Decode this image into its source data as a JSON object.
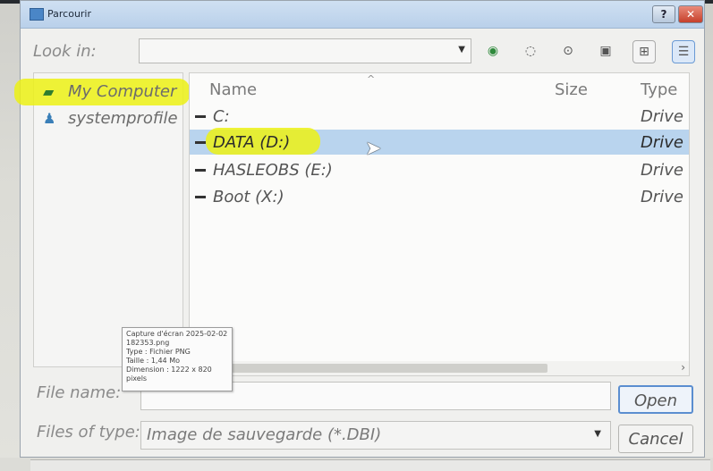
{
  "window": {
    "title": "Parcourir",
    "help_label": "?",
    "close_label": "✕"
  },
  "toolbar": {
    "lookin_label": "Look in:",
    "lookin_value": "",
    "icons": [
      "back-icon",
      "forward-icon",
      "up-icon",
      "new-folder-icon",
      "list-view-icon",
      "detail-view-icon"
    ]
  },
  "sidebar": {
    "items": [
      {
        "label": "My Computer",
        "icon": "computer-icon"
      },
      {
        "label": "systemprofile",
        "icon": "user-profile-icon"
      }
    ]
  },
  "filelist": {
    "columns": {
      "name": "Name",
      "size": "Size",
      "type": "Type"
    },
    "rows": [
      {
        "name": "C:",
        "size": "",
        "type": "Drive",
        "selected": false
      },
      {
        "name": "DATA (D:)",
        "size": "",
        "type": "Drive",
        "selected": true
      },
      {
        "name": "HASLEOBS (E:)",
        "size": "",
        "type": "Drive",
        "selected": false
      },
      {
        "name": "Boot (X:)",
        "size": "",
        "type": "Drive",
        "selected": false
      }
    ]
  },
  "form": {
    "file_name_label": "File name:",
    "file_name_value": "",
    "files_of_type_label": "Files of type:",
    "files_of_type_value": "Image de sauvegarde (*.DBI)",
    "open_label": "Open",
    "cancel_label": "Cancel"
  },
  "tooltip": {
    "lines": [
      "Capture d'écran 2025-02-02",
      "182353.png",
      "Type : Fichier PNG",
      "Taille : 1,44 Mo",
      "Dimension : 1222 x 820",
      "pixels"
    ]
  }
}
